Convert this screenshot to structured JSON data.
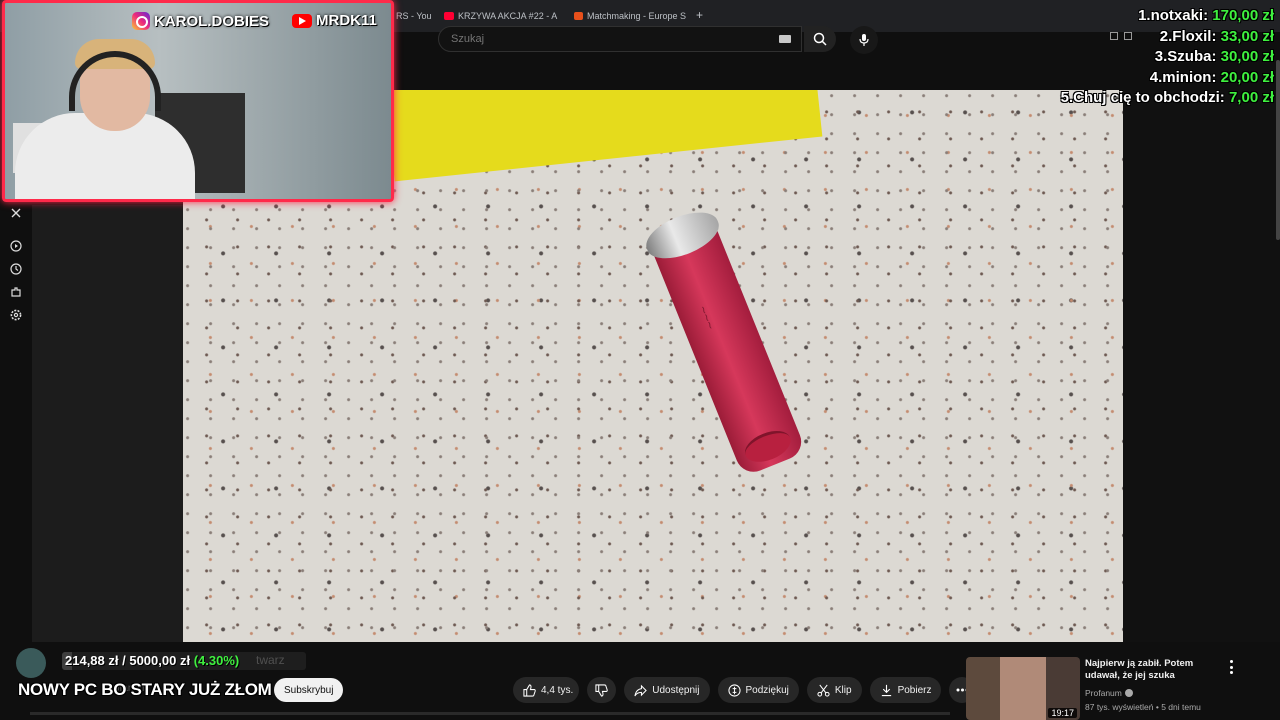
{
  "browser": {
    "tabs": [
      {
        "label": "RS - You"
      },
      {
        "label": "KRZYWA AKCJA #22 - A"
      },
      {
        "label": "Matchmaking - Europe S"
      }
    ]
  },
  "youtube": {
    "search_placeholder": "Szukaj"
  },
  "stream_overlay": {
    "instagram_handle": "KAROL.DOBIES",
    "youtube_handle": "MRDK11",
    "leaderboard": [
      {
        "rank_name": "1.notxaki:",
        "amount": "170,00 zł"
      },
      {
        "rank_name": "2.Floxil:",
        "amount": "33,00 zł"
      },
      {
        "rank_name": "3.Szuba:",
        "amount": "30,00 zł"
      },
      {
        "rank_name": "4.minion:",
        "amount": "20,00 zł"
      },
      {
        "rank_name": "5.Chuj cię to obchodzi:",
        "amount": "7,00 zł"
      }
    ],
    "goal": {
      "current": "214,88 zł",
      "separator": " / ",
      "target": "5000,00 zł",
      "percent_label": "(4.30%)",
      "progress": 0.043
    },
    "stream_title": "NOWY PC BO STARY JUŻ ZŁOM"
  },
  "video_info": {
    "channel_name": "Profanum",
    "faded_text": "twarz",
    "subscribe_label": "Subskrybuj",
    "actions": {
      "like_count": "4,4 tys.",
      "share": "Udostępnij",
      "thanks": "Podziękuj",
      "clip": "Klip",
      "download": "Pobierz"
    }
  },
  "related": {
    "title": "Najpierw ją zabił. Potem udawał, że jej szuka",
    "channel": "Profanum",
    "meta": "87 tys. wyświetleń • 5 dni temu",
    "duration": "19:17"
  },
  "colors": {
    "webcam_border": "#ff2a4a",
    "leaderboard_amount": "#3ff03f",
    "yt_red": "#ff0000"
  }
}
